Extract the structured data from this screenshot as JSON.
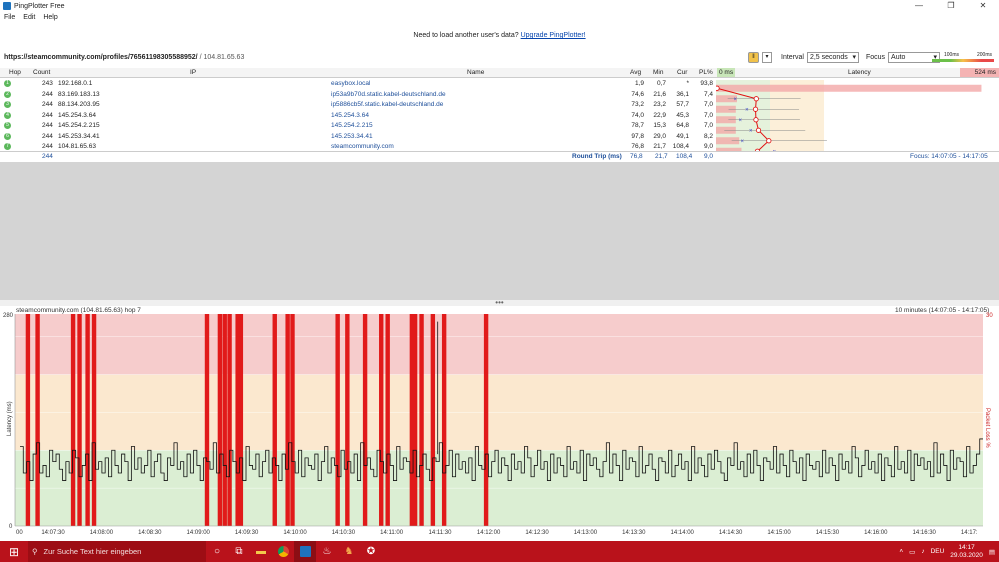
{
  "window": {
    "title": "PingPlotter Free",
    "minimize": "—",
    "maximize": "❐",
    "close": "✕"
  },
  "menu": [
    "File",
    "Edit",
    "Help"
  ],
  "promo": {
    "text": "Need to load another user's data?",
    "link": "Upgrade PingPlotter!"
  },
  "target": {
    "url": "https://steamcommunity.com/profiles/76561198305588952/",
    "ip": " / 104.81.65.63"
  },
  "controls": {
    "interval_label": "Interval",
    "interval_value": "2,5 seconds",
    "focus_label": "Focus",
    "focus_value": "Auto"
  },
  "scale": {
    "low": "100ms",
    "high": "200ms"
  },
  "table": {
    "headers": {
      "hop": "Hop",
      "count": "Count",
      "ip": "IP",
      "name": "Name",
      "avg": "Avg",
      "min": "Min",
      "cur": "Cur",
      "pl": "PL%",
      "latency_min": "0 ms",
      "latency": "Latency",
      "latency_max": "524 ms"
    },
    "rows": [
      {
        "hop": "1",
        "count": "243",
        "ip": "192.168.0.1",
        "name": "easybox.local",
        "avg": "1,9",
        "min": "0,7",
        "cur": "*",
        "pl": "93,8"
      },
      {
        "hop": "2",
        "count": "244",
        "ip": "83.169.183.13",
        "name": "ip53a9b70d.static.kabel-deutschland.de",
        "avg": "74,6",
        "min": "21,6",
        "cur": "36,1",
        "pl": "7,4"
      },
      {
        "hop": "3",
        "count": "244",
        "ip": "88.134.203.95",
        "name": "ip5886cb5f.static.kabel-deutschland.de",
        "avg": "73,2",
        "min": "23,2",
        "cur": "57,7",
        "pl": "7,0"
      },
      {
        "hop": "4",
        "count": "244",
        "ip": "145.254.3.64",
        "name": "145.254.3.64",
        "avg": "74,0",
        "min": "22,9",
        "cur": "45,3",
        "pl": "7,0"
      },
      {
        "hop": "5",
        "count": "244",
        "ip": "145.254.2.215",
        "name": "145.254.2.215",
        "avg": "78,7",
        "min": "15,3",
        "cur": "64,8",
        "pl": "7,0"
      },
      {
        "hop": "6",
        "count": "244",
        "ip": "145.253.34.41",
        "name": "145.253.34.41",
        "avg": "97,8",
        "min": "29,0",
        "cur": "49,1",
        "pl": "8,2"
      },
      {
        "hop": "7",
        "count": "244",
        "ip": "104.81.65.63",
        "name": "steamcommunity.com",
        "avg": "76,8",
        "min": "21,7",
        "cur": "108,4",
        "pl": "9,0"
      }
    ],
    "totals": {
      "count": "244",
      "label": "Round Trip (ms)",
      "avg": "76,8",
      "min": "21,7",
      "cur": "108,4",
      "pl": "9,0",
      "focus": "Focus: 14:07:05 - 14:17:05"
    }
  },
  "chart_data": {
    "type": "line",
    "title": "steamcommunity.com (104.81.65.63) hop 7",
    "range_label": "10 minutes (14:07:05 - 14:17:05)",
    "ylabel": "Latency (ms)",
    "y2label": "Packet Loss %",
    "ylim": [
      0,
      280
    ],
    "y2max": "30",
    "ytick_top": "280",
    "ytick_bottom": "0",
    "xticks": [
      "00",
      "14:07:30",
      "14:08:00",
      "14:08:30",
      "14:09:00",
      "14:09:30",
      "14:10:00",
      "14:10:30",
      "14:11:00",
      "14:11:30",
      "14:12:00",
      "14:12:30",
      "14:13:00",
      "14:13:30",
      "14:14:00",
      "14:14:30",
      "14:15:00",
      "14:15:30",
      "14:16:00",
      "14:16:30",
      "14:17:"
    ],
    "bands": [
      {
        "from": 0,
        "to": 100,
        "color": "#dbeed3"
      },
      {
        "from": 100,
        "to": 200,
        "color": "#fbe8cf"
      },
      {
        "from": 200,
        "to": 280,
        "color": "#f6cccc"
      }
    ],
    "loss_times_s": [
      8,
      14,
      36,
      40,
      45,
      49,
      119,
      127,
      130,
      133,
      138,
      140,
      161,
      169,
      172,
      200,
      206,
      217,
      227,
      231,
      246,
      248,
      252,
      259,
      266,
      292
    ],
    "latency_ms": [
      105,
      70,
      85,
      60,
      95,
      110,
      70,
      80,
      65,
      100,
      85,
      95,
      75,
      60,
      85,
      70,
      100,
      90,
      65,
      80,
      95,
      60,
      110,
      75,
      85,
      70,
      90,
      65,
      100,
      80,
      70,
      95,
      85,
      60,
      105,
      75,
      90,
      70,
      80,
      100,
      65,
      85,
      95,
      70,
      60,
      90,
      80,
      110,
      75,
      85,
      65,
      95,
      70,
      100,
      80,
      60,
      90,
      85,
      75,
      110,
      70,
      95,
      80,
      65,
      100,
      85,
      70,
      90,
      60,
      105,
      80,
      75,
      95,
      65,
      85,
      100,
      70,
      90,
      80,
      60,
      95,
      75,
      110,
      85,
      70,
      100,
      65,
      90,
      80,
      75,
      95,
      60,
      85,
      105,
      70,
      90,
      80,
      65,
      100,
      75,
      85,
      70,
      95,
      60,
      110,
      80,
      90,
      75,
      65,
      100,
      85,
      70,
      95,
      80,
      60,
      105,
      75,
      90,
      85,
      70,
      100,
      65,
      80,
      95,
      75,
      60,
      90,
      85,
      110,
      70,
      80,
      100,
      65,
      95,
      75,
      85,
      70,
      90,
      60,
      105,
      80,
      75,
      95,
      65,
      85,
      100,
      70,
      90,
      80,
      60,
      95,
      75,
      85,
      70,
      105,
      90,
      65,
      80,
      100,
      75,
      85,
      60,
      95,
      70,
      90,
      80,
      65,
      105,
      75,
      85,
      70,
      100,
      60,
      95,
      80,
      90,
      75,
      65,
      85,
      110,
      70,
      95,
      80,
      60,
      100,
      75,
      90,
      85,
      65,
      105,
      70,
      80,
      95,
      75,
      60,
      90,
      85,
      70,
      100,
      65,
      80,
      95,
      75,
      85,
      60,
      105,
      70,
      90,
      80,
      65,
      95,
      75,
      100,
      85,
      70,
      60,
      90,
      80,
      110,
      75,
      85,
      65,
      95,
      70,
      100,
      80,
      60,
      90,
      85,
      75,
      105,
      70,
      95,
      80,
      65,
      100,
      85,
      70,
      90,
      60,
      95,
      80,
      75,
      85,
      65,
      100,
      70,
      90,
      80,
      60,
      95,
      75,
      85,
      70,
      105,
      90,
      65,
      80,
      100,
      75,
      85,
      70,
      95,
      60,
      90,
      80,
      65,
      105,
      75,
      85,
      70,
      100,
      60,
      95,
      80,
      90,
      75,
      85,
      65,
      110,
      70,
      95,
      80,
      60,
      100,
      75,
      90,
      85,
      65,
      105,
      70,
      80,
      95,
      115
    ]
  },
  "taskbar": {
    "search_placeholder": "Zur Suche Text hier eingeben",
    "time": "14:17",
    "date": "29.03.2020",
    "lang": "DEU"
  },
  "colors": {
    "loss": "#e11a1a",
    "taskbar": "#b9121b",
    "focus_line": "#e01010"
  }
}
